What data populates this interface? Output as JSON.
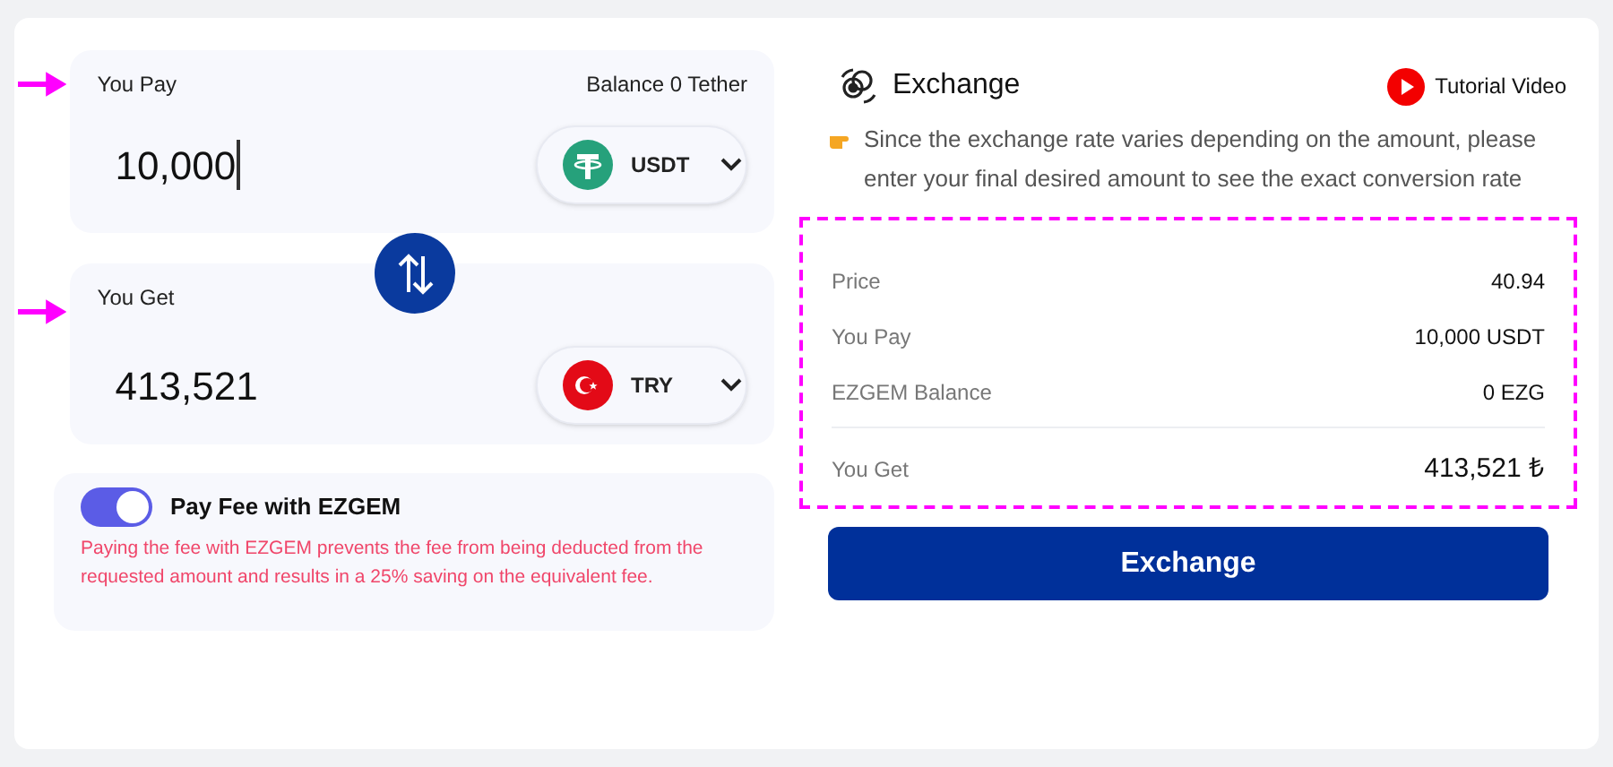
{
  "pay": {
    "label": "You Pay",
    "balance": "Balance 0 Tether",
    "value": "10,000",
    "focused": true,
    "currency": {
      "code": "USDT",
      "kind": "tether"
    }
  },
  "get": {
    "label": "You Get",
    "value": "413,521",
    "currency": {
      "code": "TRY",
      "kind": "turkey"
    }
  },
  "fee": {
    "on": true,
    "label": "Pay Fee with EZGEM",
    "note": "Paying the fee with EZGEM prevents the fee from being deducted from the requested amount and results in a 25% saving on the equivalent fee."
  },
  "header": {
    "title": "Exchange",
    "tutorial": "Tutorial Video"
  },
  "hint": "Since the exchange rate varies depending on the amount, please enter your final desired amount to see the exact conversion rate",
  "summary": [
    {
      "label": "Price",
      "value": "40.94",
      "kind": "row"
    },
    {
      "label": "You Pay",
      "value": "10,000 USDT",
      "kind": "row"
    },
    {
      "label": "EZGEM Balance",
      "value": "0 EZG",
      "kind": "row"
    },
    {
      "label": "You Get",
      "value": "413,521 ₺",
      "kind": "total"
    }
  ],
  "button": "Exchange"
}
